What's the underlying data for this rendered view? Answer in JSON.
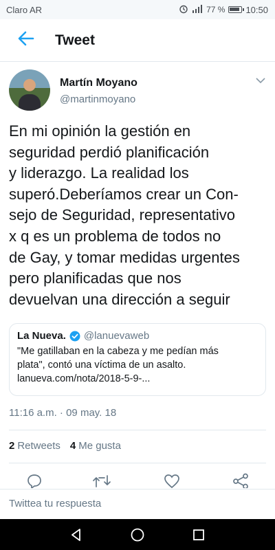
{
  "status_bar": {
    "carrier": "Claro AR",
    "signal": "ᴴᴳ",
    "battery_percent": "77 %",
    "time": "10:50"
  },
  "header": {
    "title": "Tweet",
    "back_icon": "arrow-left-icon"
  },
  "tweet": {
    "author_name": "Martín Moyano",
    "author_handle": "@martinmoyano",
    "text_lines": [
      "En mi opinión la gestión en",
      "seguridad perdió planificación",
      "y liderazgo. La realidad los",
      "superó.Deberíamos crear un Con-",
      "sejo de Seguridad, representativo",
      "x q es un problema de todos no",
      "de Gay, y tomar medidas urgentes",
      "pero planificadas que nos",
      "devuelvan una dirección a seguir"
    ],
    "timestamp": "11:16 a.m. · 09 may. 18"
  },
  "quote": {
    "name": "La Nueva.",
    "handle": "@lanuevaweb",
    "body_lines": [
      "\"Me gatillaban en la cabeza y me pedían más",
      "plata\", contó una víctima de un asalto.",
      "lanueva.com/nota/2018-5-9-..."
    ]
  },
  "stats": {
    "retweets_count": "2",
    "retweets_label": "Retweets",
    "likes_count": "4",
    "likes_label": "Me gusta"
  },
  "reply": {
    "placeholder": "Twittea tu respuesta"
  },
  "colors": {
    "accent": "#1da1f2",
    "secondary_text": "#657786",
    "border": "#e1e8ed"
  },
  "icons": [
    "alarm-icon",
    "signal-icon",
    "battery-icon",
    "verified-badge-icon",
    "reply-icon",
    "retweet-icon",
    "like-icon",
    "share-icon",
    "nav-back-icon",
    "nav-home-icon",
    "nav-recents-icon"
  ]
}
